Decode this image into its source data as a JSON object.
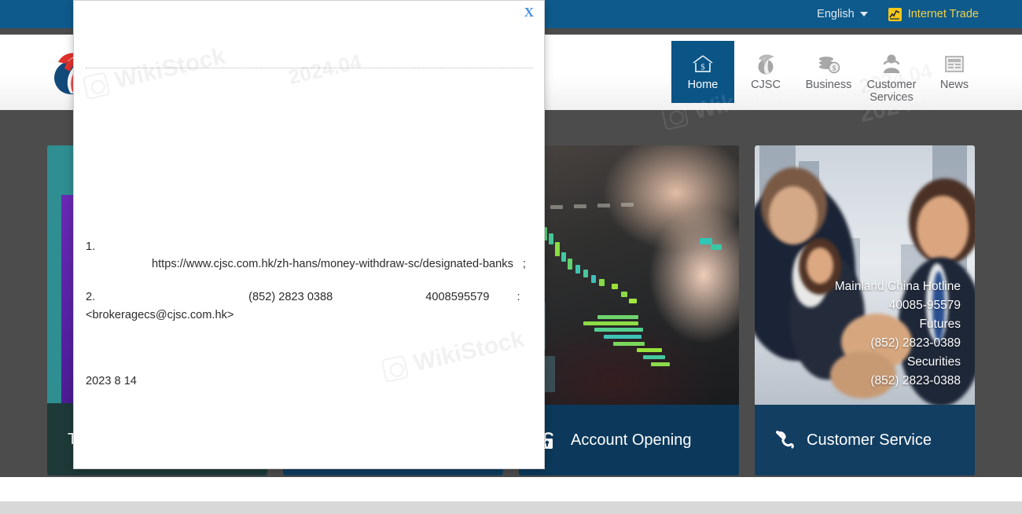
{
  "topbar": {
    "language": "English",
    "language_caret_icon": "chevron-down-icon",
    "internet_trade": "Internet Trade",
    "internet_trade_icon": "chart-line-icon",
    "bg_color": "#0e5a8c",
    "trade_color": "#f2d14a"
  },
  "header": {
    "logo_alt": "cjsc-logo",
    "nav": [
      {
        "label": "Home",
        "icon": "home-dollar-icon",
        "active": true
      },
      {
        "label": "CJSC",
        "icon": "flame-sphere-icon",
        "active": false
      },
      {
        "label": "Business",
        "icon": "coins-dollar-icon",
        "active": false
      },
      {
        "label": "Customer Services",
        "icon": "customer-person-icon",
        "active": false
      },
      {
        "label": "News",
        "icon": "newspaper-icon",
        "active": false
      }
    ],
    "active_color": "#0a5486"
  },
  "stage": {
    "bg_color": "#4c4c4c",
    "cards": [
      {
        "id": "card-a",
        "footer_label": "TW",
        "footer_icon": ""
      },
      {
        "id": "card-b",
        "footer_label": "",
        "footer_icon": ""
      },
      {
        "id": "card-c",
        "footer_label": "Account Opening",
        "footer_icon": "unlock-icon"
      },
      {
        "id": "card-d",
        "footer_label": "Customer Service",
        "footer_icon": "phone-icon"
      }
    ],
    "contact": {
      "line1": "Mainland China Hotline",
      "line2": "40085-95579",
      "line3": "Futures",
      "line4": "(852) 2823-0389",
      "line5": "Securities",
      "line6": "(852) 2823-0388"
    }
  },
  "modal": {
    "title": "",
    "close_label": "X",
    "close_color": "#4a90e2",
    "item1_num": "1.",
    "item1_url": "https://www.cjsc.com.hk/zh-hans/money-withdraw-sc/designated-banks",
    "item1_semicolon": ";",
    "item2_num": "2.",
    "item2_phone_hk": "(852) 2823 0388",
    "item2_phone_cn": "4008595579",
    "item2_colon": ":",
    "item2_email": "<brokeragecs@cjsc.com.hk>",
    "date": "2023  8  14"
  },
  "watermarks": {
    "brand": "WikiStock",
    "version": "2024.04"
  }
}
